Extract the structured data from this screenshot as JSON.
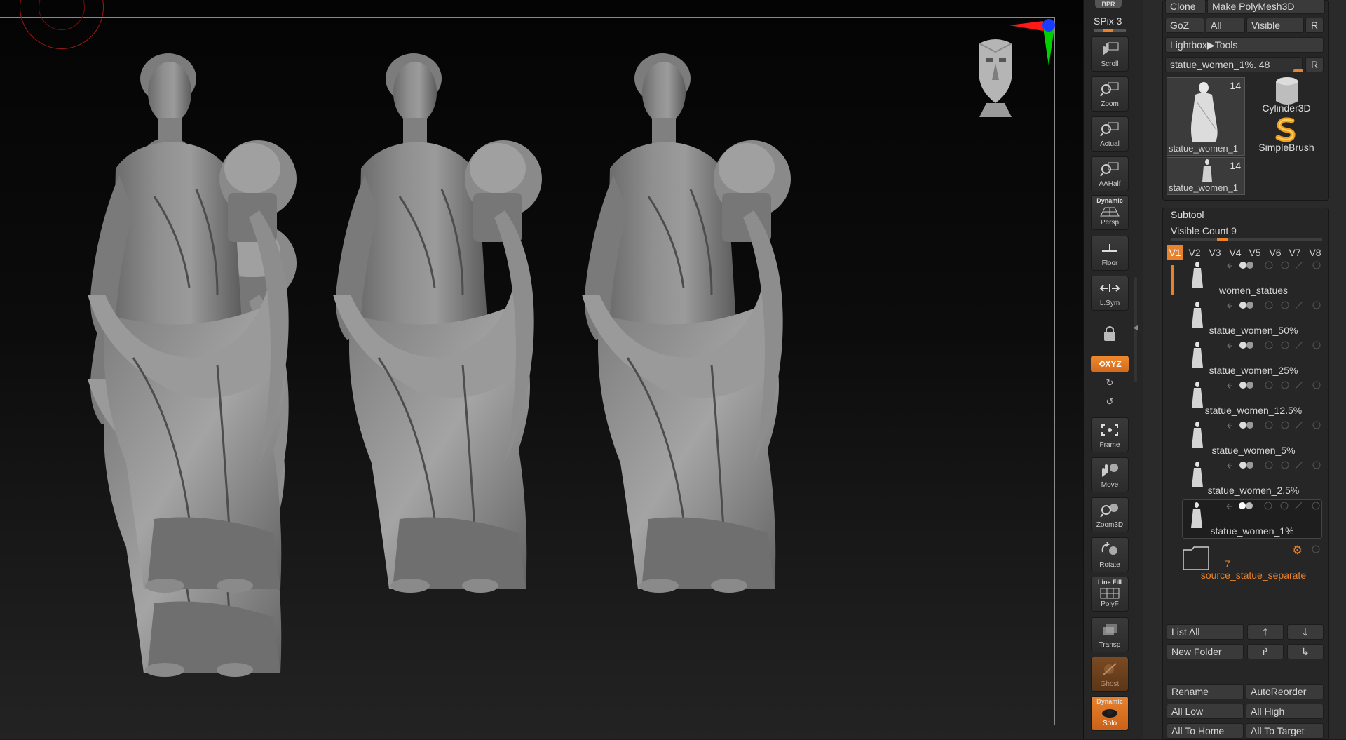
{
  "shelf": {
    "bpr": "BPR",
    "spix": "SPix 3",
    "buttons": [
      {
        "key": "scroll",
        "label": "Scroll"
      },
      {
        "key": "zoom",
        "label": "Zoom"
      },
      {
        "key": "actual",
        "label": "Actual"
      },
      {
        "key": "aahalf",
        "label": "AAHalf"
      },
      {
        "key": "persp",
        "label": "Persp",
        "top_label": "Dynamic"
      },
      {
        "key": "floor",
        "label": "Floor"
      },
      {
        "key": "lsym",
        "label": "L.Sym"
      },
      {
        "key": "frame",
        "label": "Frame"
      },
      {
        "key": "move",
        "label": "Move"
      },
      {
        "key": "zoom3d",
        "label": "Zoom3D"
      },
      {
        "key": "rotate",
        "label": "Rotate"
      },
      {
        "key": "polyf",
        "label": "PolyF",
        "top_label": "Line Fill"
      },
      {
        "key": "transp",
        "label": "Transp"
      },
      {
        "key": "ghost",
        "label": "Ghost"
      },
      {
        "key": "solo",
        "label": "Solo",
        "top_label": "Dynamic"
      }
    ],
    "xyz": "XYZ"
  },
  "tool": {
    "clone": "Clone",
    "make_polymesh": "Make PolyMesh3D",
    "goz": "GoZ",
    "all": "All",
    "visible": "Visible",
    "r": "R",
    "lightbox_tools": "Lightbox▶Tools",
    "current_tool": "statue_women_1%. 48",
    "thumbs": [
      {
        "name": "statue_women_1",
        "count": "14"
      },
      {
        "name": "statue_women_1",
        "count": "14"
      }
    ],
    "cylinder": "Cylinder3D",
    "simplebrush": "SimpleBrush"
  },
  "subtool": {
    "title": "Subtool",
    "visible_count": "Visible Count 9",
    "tabs": [
      "V1",
      "V2",
      "V3",
      "V4",
      "V5",
      "V6",
      "V7",
      "V8"
    ],
    "items": [
      {
        "name": "women_statues"
      },
      {
        "name": "statue_women_50%"
      },
      {
        "name": "statue_women_25%"
      },
      {
        "name": "statue_women_12.5%"
      },
      {
        "name": "statue_women_5%"
      },
      {
        "name": "statue_women_2.5%"
      },
      {
        "name": "statue_women_1%"
      }
    ],
    "folder": {
      "count": "7",
      "name": "source_statue_separate"
    },
    "buttons": {
      "list_all": "List All",
      "new_folder": "New Folder",
      "rename": "Rename",
      "auto_reorder": "AutoReorder",
      "all_low": "All Low",
      "all_high": "All High",
      "all_to_home": "All To Home",
      "all_to_target": "All To Target"
    }
  },
  "colors": {
    "accent": "#e8822c",
    "axis_x": "#ff1a1a",
    "axis_y": "#00d000",
    "axis_z": "#1a3cff"
  }
}
